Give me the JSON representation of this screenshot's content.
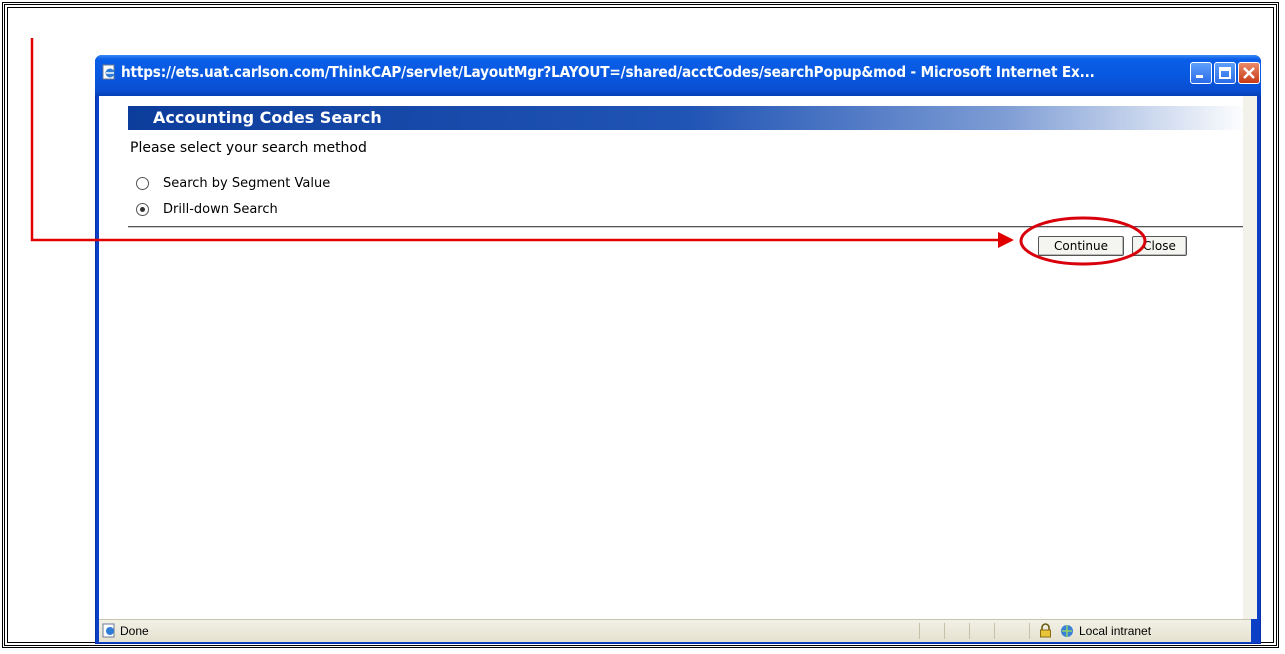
{
  "window": {
    "title": "https://ets.uat.carlson.com/ThinkCAP/servlet/LayoutMgr?LAYOUT=/shared/acctCodes/searchPopup&mod - Microsoft Internet Ex...",
    "icon": "ie-page-icon",
    "controls": [
      "minimize-icon",
      "maximize-icon",
      "close-icon"
    ]
  },
  "panel": {
    "header": "Accounting Codes Search",
    "prompt": "Please select your search method",
    "options": [
      {
        "label": "Search by Segment Value",
        "selected": false
      },
      {
        "label": "Drill-down Search",
        "selected": true
      }
    ],
    "buttons": {
      "continue": "Continue",
      "close": "Close"
    }
  },
  "statusbar": {
    "status": "Done",
    "zone": "Local intranet"
  },
  "colors": {
    "title_blue": "#0758e0",
    "header_blue": "#0c3d9c",
    "annotation_red": "#e00000"
  }
}
